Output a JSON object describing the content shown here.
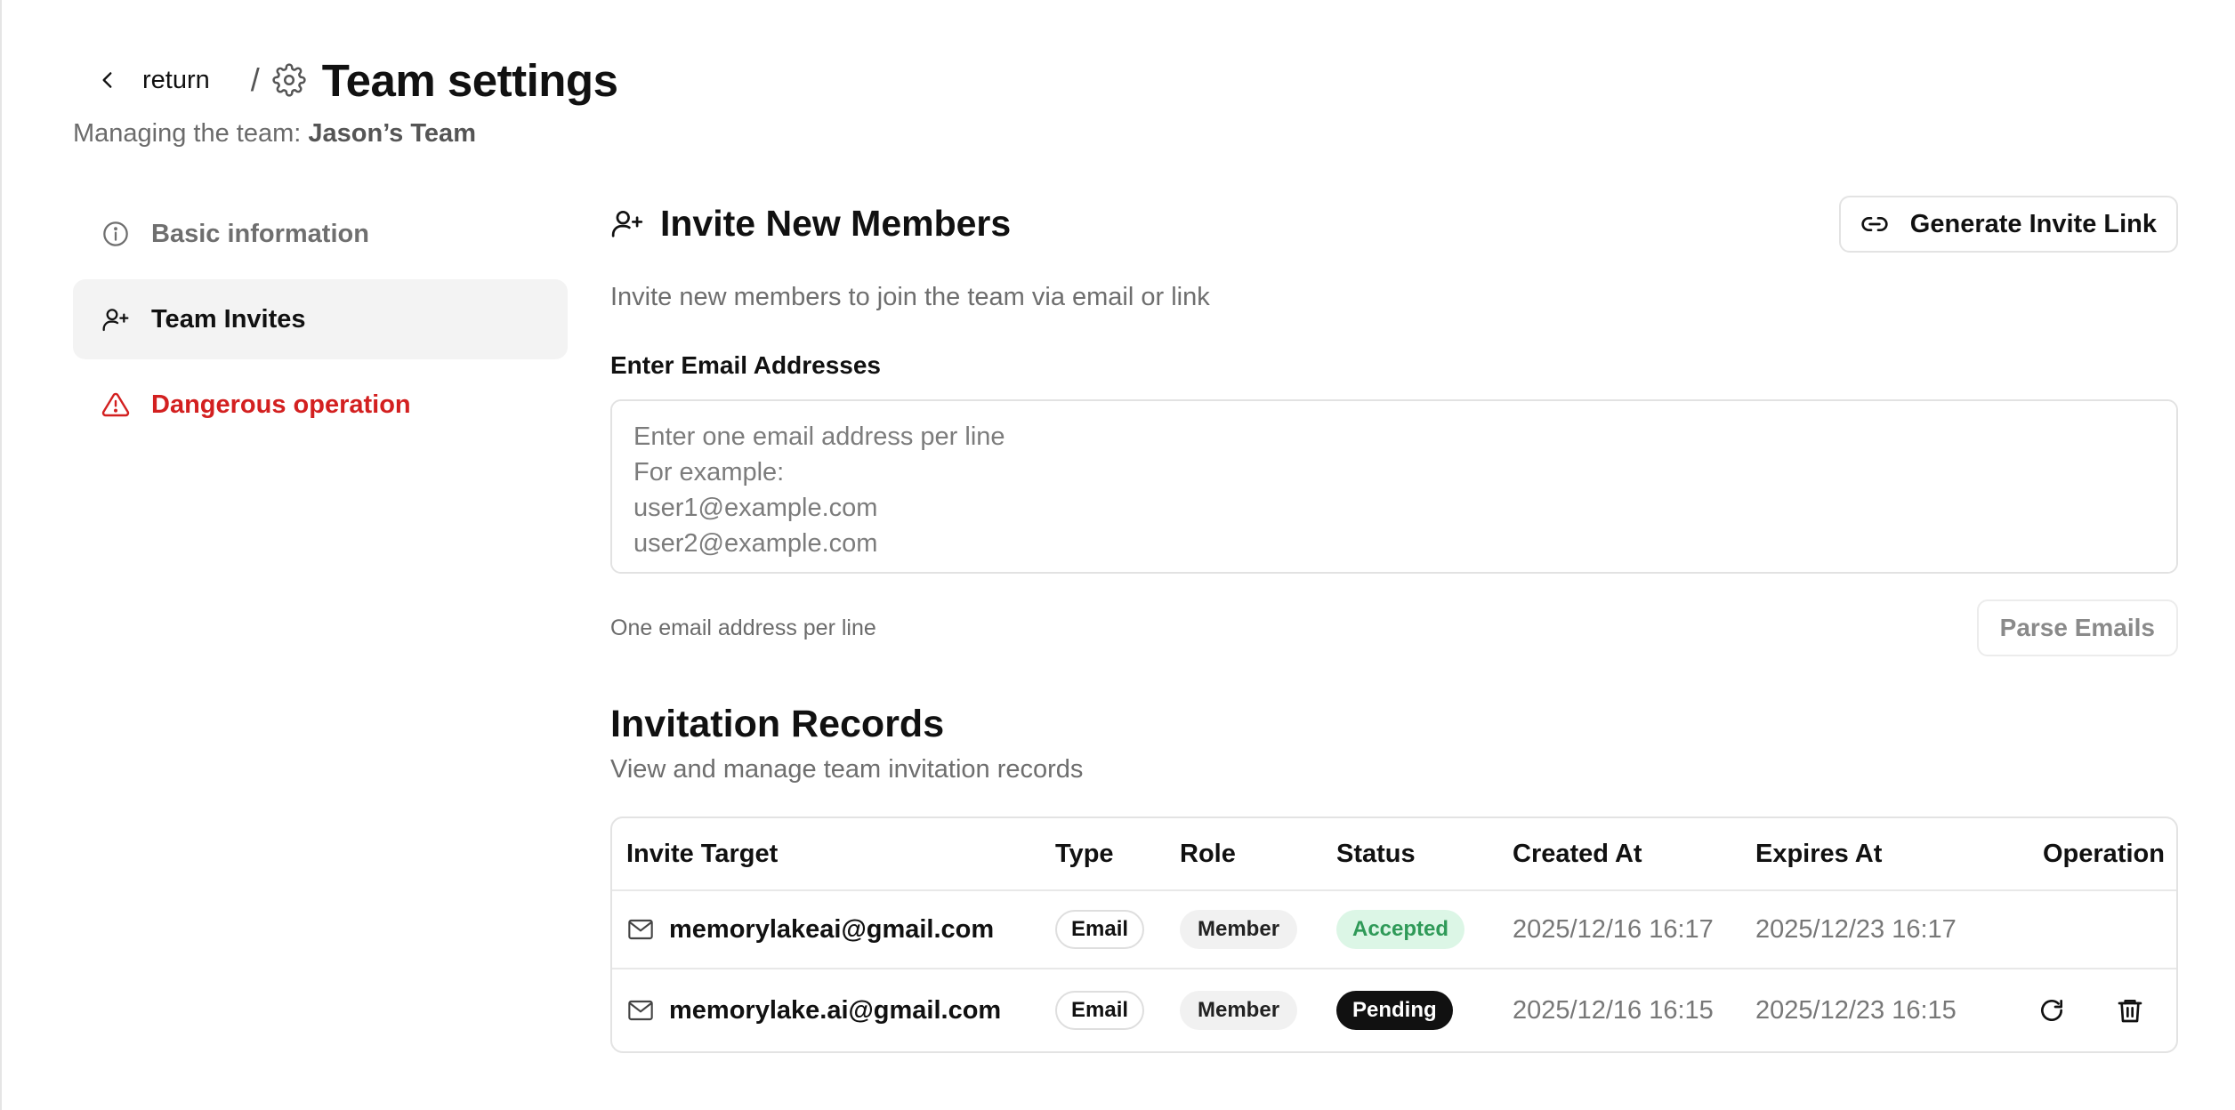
{
  "header": {
    "back_label": "return",
    "separator": "/",
    "title": "Team settings",
    "subtitle_prefix": "Managing the team:",
    "team_name": "Jason’s Team"
  },
  "sidebar": {
    "items": [
      {
        "label": "Basic information",
        "icon": "info-icon",
        "state": "default"
      },
      {
        "label": "Team Invites",
        "icon": "user-plus-icon",
        "state": "active"
      },
      {
        "label": "Dangerous operation",
        "icon": "warning-icon",
        "state": "danger",
        "color": "#d32020"
      }
    ]
  },
  "invite": {
    "title": "Invite New Members",
    "generate_link_label": "Generate Invite Link",
    "description": "Invite new members to join the team via email or link",
    "field_label": "Enter Email Addresses",
    "placeholder": "Enter one email address per line\nFor example:\nuser1@example.com\nuser2@example.com",
    "value": "",
    "hint": "One email address per line",
    "parse_label": "Parse Emails"
  },
  "records": {
    "title": "Invitation Records",
    "description": "View and manage team invitation records",
    "columns": [
      "Invite Target",
      "Type",
      "Role",
      "Status",
      "Created At",
      "Expires At",
      "Operation"
    ],
    "rows": [
      {
        "target": "memorylakeai@gmail.com",
        "type": "Email",
        "role": "Member",
        "status": "Accepted",
        "created": "2025/12/16 16:17",
        "expires": "2025/12/23 16:17",
        "operations": []
      },
      {
        "target": "memorylake.ai@gmail.com",
        "type": "Email",
        "role": "Member",
        "status": "Pending",
        "created": "2025/12/16 16:15",
        "expires": "2025/12/23 16:15",
        "operations": [
          "refresh-icon",
          "trash-icon"
        ]
      }
    ]
  },
  "colors": {
    "danger": "#d32020",
    "accepted_bg": "#dcf6e6",
    "accepted_text": "#2f9a58",
    "pending_bg": "#111111"
  }
}
